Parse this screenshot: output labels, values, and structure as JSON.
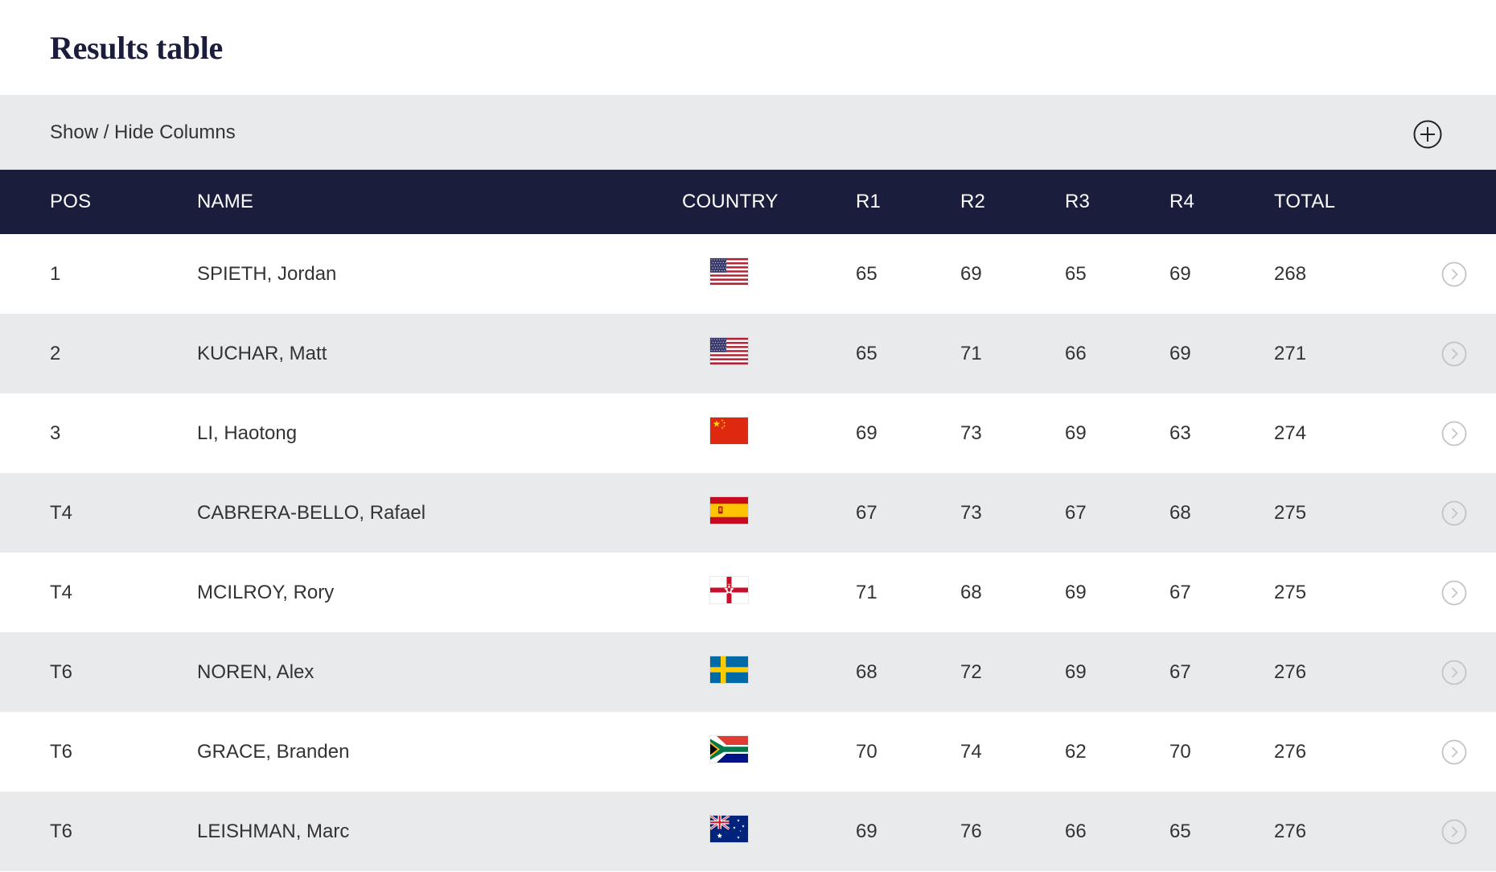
{
  "page": {
    "title": "Results table"
  },
  "toggle": {
    "label": "Show / Hide Columns",
    "icon": "plus-circle-icon"
  },
  "columns": [
    "POS",
    "NAME",
    "COUNTRY",
    "R1",
    "R2",
    "R3",
    "R4",
    "TOTAL"
  ],
  "rows": [
    {
      "pos": "1",
      "name": "SPIETH, Jordan",
      "country_flag": "usa-flag-icon",
      "r1": "65",
      "r2": "69",
      "r3": "65",
      "r4": "69",
      "total": "268"
    },
    {
      "pos": "2",
      "name": "KUCHAR, Matt",
      "country_flag": "usa-flag-icon",
      "r1": "65",
      "r2": "71",
      "r3": "66",
      "r4": "69",
      "total": "271"
    },
    {
      "pos": "3",
      "name": "LI, Haotong",
      "country_flag": "china-flag-icon",
      "r1": "69",
      "r2": "73",
      "r3": "69",
      "r4": "63",
      "total": "274"
    },
    {
      "pos": "T4",
      "name": "CABRERA-BELLO, Rafael",
      "country_flag": "spain-flag-icon",
      "r1": "67",
      "r2": "73",
      "r3": "67",
      "r4": "68",
      "total": "275"
    },
    {
      "pos": "T4",
      "name": "MCILROY, Rory",
      "country_flag": "northern-ireland-flag-icon",
      "r1": "71",
      "r2": "68",
      "r3": "69",
      "r4": "67",
      "total": "275"
    },
    {
      "pos": "T6",
      "name": "NOREN, Alex",
      "country_flag": "sweden-flag-icon",
      "r1": "68",
      "r2": "72",
      "r3": "69",
      "r4": "67",
      "total": "276"
    },
    {
      "pos": "T6",
      "name": "GRACE, Branden",
      "country_flag": "south-africa-flag-icon",
      "r1": "70",
      "r2": "74",
      "r3": "62",
      "r4": "70",
      "total": "276"
    },
    {
      "pos": "T6",
      "name": "LEISHMAN, Marc",
      "country_flag": "australia-flag-icon",
      "r1": "69",
      "r2": "76",
      "r3": "66",
      "r4": "65",
      "total": "276"
    }
  ],
  "row_action_icon": "chevron-right-circle-icon",
  "colors": {
    "header_bg": "#1b1d3d",
    "header_text": "#ffffff",
    "stripe_bg": "#e9eaec",
    "title": "#1b1d3d",
    "row_icon": "#c2c4c8"
  }
}
